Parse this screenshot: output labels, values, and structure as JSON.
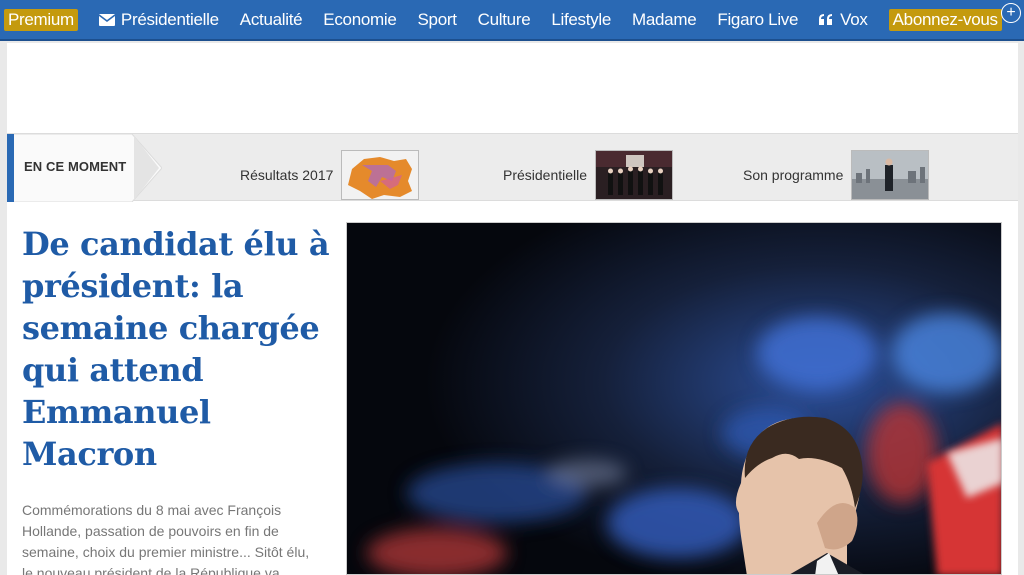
{
  "nav": {
    "premium": "Premium",
    "items": [
      "Présidentielle",
      "Actualité",
      "Economie",
      "Sport",
      "Culture",
      "Lifestyle",
      "Madame",
      "Figaro Live",
      "Vox"
    ],
    "subscribe": "Abonnez-vous",
    "icons": {
      "presidentielle": "envelope-icon",
      "vox": "quote-icon",
      "more": "plus-circle-icon"
    }
  },
  "trend": {
    "label": "EN CE MOMENT",
    "links": [
      {
        "label": "Résultats 2017",
        "thumb": "france-map-thumbnail"
      },
      {
        "label": "Présidentielle",
        "thumb": "debate-stage-thumbnail"
      },
      {
        "label": "Son programme",
        "thumb": "candidate-standing-thumbnail"
      }
    ]
  },
  "article": {
    "headline": "De candidat élu à président: la semaine chargée qui attend Emmanuel Macron",
    "summary": "Commémorations du 8 mai avec François Hollande, passation de pouvoirs en fin de semaine, choix du premier ministre... Sitôt élu, le nouveau président de la République va",
    "image": "macron-profile-flags-photo"
  },
  "colors": {
    "navBlue": "#2a69b4",
    "gold": "#c49a0e",
    "headlineBlue": "#1f5ba6"
  }
}
